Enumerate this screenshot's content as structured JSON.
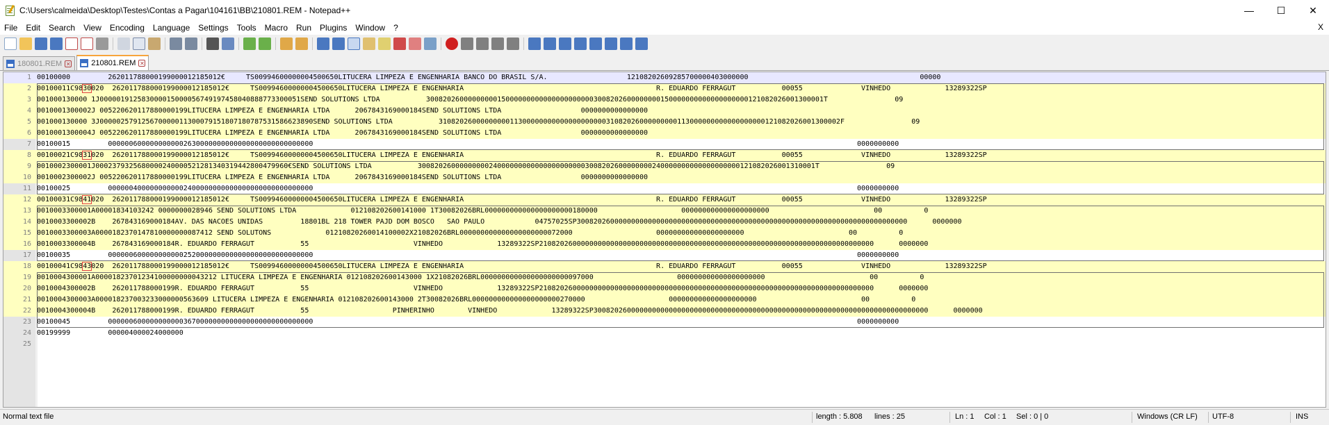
{
  "window": {
    "title": "C:\\Users\\calmeida\\Desktop\\Testes\\Contas a Pagar\\104161\\BB\\210801.REM - Notepad++",
    "minimize": "—",
    "maximize": "☐",
    "close": "✕"
  },
  "menu": {
    "items": [
      "File",
      "Edit",
      "Search",
      "View",
      "Encoding",
      "Language",
      "Settings",
      "Tools",
      "Macro",
      "Run",
      "Plugins",
      "Window",
      "?"
    ],
    "close_doc": "X"
  },
  "tabs": [
    {
      "label": "180801.REM",
      "active": false
    },
    {
      "label": "210801.REM",
      "active": true
    }
  ],
  "editor": {
    "lines": [
      {
        "n": "1",
        "text": "00100000         262011788000199000012185012€     TS00994600000004500650LITUCERA LIMPEZA E ENGENHARIA BANCO DO BRASIL S/A.                   12108202609285700000403000000                                         00000",
        "pre": "",
        "mark": "",
        "post": ""
      },
      {
        "n": "2",
        "pre": "00100011C98",
        "mark": "30",
        "post": "020  262011788000199000012185012€     TS00994600000004500650LITUCERA LIMPEZA E ENGENHARIA                                              R. EDUARDO FERRAGUT           00055              VINHEDO             13289322SP"
      },
      {
        "n": "3",
        "pre": "",
        "mark": "",
        "post": "001000130000 1J000001912583000015000056749197458040888773300051SEND SOLUTIONS LTDA           30082026000000000150000000000000000000003008202600000000150000000000000000000121082026001300001T                09"
      },
      {
        "n": "4",
        "pre": "",
        "mark": "",
        "post": "0010001300002J 005220620117880000199LITUCERA LIMPEZA E ENGENHARIA LTDA      2067843169000184SEND SOLUTIONS LTDA                   0000000000000000"
      },
      {
        "n": "5",
        "pre": "",
        "mark": "",
        "post": "001000130000 3J000002579125670000011300079151807180787531586623890SEND SOLUTIONS LTDA           310820260000000001130000000000000000000031082026000000000113000000000000000000121082026001300002F                09"
      },
      {
        "n": "6",
        "pre": "",
        "mark": "",
        "post": "0010001300004J 005220620117880000199LITUCERA LIMPEZA E ENGENHARIA LTDA      2067843169000184SEND SOLUTIONS LTDA                   0000000000000000"
      },
      {
        "n": "7",
        "pre": "",
        "mark": "",
        "post": "00100015         0000006000000000002630000000000000000000000000000                                                                                                                                  0000000000"
      },
      {
        "n": "8",
        "pre": "00100021C98",
        "mark": "31",
        "post": "020  262011788000199000012185012€     TS00994600000004500650LITUCERA LIMPEZA E ENGENHARIA                                              R. EDUARDO FERRAGUT           00055              VINHEDO             13289322SP"
      },
      {
        "n": "9",
        "pre": "",
        "mark": "",
        "post": "0010002300001J0002379325680000240000521281340319442800479960€SEND SOLUTIONS LTDA           30082026000000000240000000000000000000003008202600000000240000000000000000000121082026001310001T                09"
      },
      {
        "n": "10",
        "pre": "",
        "mark": "",
        "post": "0010002300002J 005220620117880000199LITUCERA LIMPEZA E ENGENHARIA LTDA      2067843169000184SEND SOLUTIONS LTDA                   0000000000000000"
      },
      {
        "n": "11",
        "pre": "",
        "mark": "",
        "post": "00100025         0000004000000000002400000000000000000000000000000                                                                                                                                  0000000000"
      },
      {
        "n": "12",
        "pre": "00100031C98",
        "mark": "41",
        "post": "020  262011788000199000012185012€     TS00994600000004500650LITUCERA LIMPEZA E ENGENHARIA                                              R. EDUARDO FERRAGUT           00055              VINHEDO             13289322SP"
      },
      {
        "n": "13",
        "pre": "",
        "mark": "",
        "post": "0010003300001A00001834103242 0000000028946 SEND SOLUTIONS LTDA             012108202600141000 1T30082026BRL000000000000000000000180000                    000000000000000000000                         00          0"
      },
      {
        "n": "14",
        "pre": "",
        "mark": "",
        "post": "0010003300002B    267843169000184AV. DAS NACOES UNIDAS         18801BL 218 TOWER PAJD DOM BOSCO   SAO PAULO            04757025SP3008202600000000000000000000000000000000000000000000000000000000000000000000000      0000000"
      },
      {
        "n": "15",
        "pre": "",
        "mark": "",
        "post": "0010003300003A0000182370147810000000087412 SEND SOLUTONS             01210820260014100002X21082026BRL000000000000000000000072000                    000000000000000000000                         00          0"
      },
      {
        "n": "16",
        "pre": "",
        "mark": "",
        "post": "0010003300004B    267843169000184R. EDUARDO FERRAGUT           55                         VINHEDO             13289322SP21082026000000000000000000000000000000000000000000000000000000000000000000000000      0000000"
      },
      {
        "n": "17",
        "pre": "",
        "mark": "",
        "post": "00100035         0000006000000000002520000000000000000000000000000                                                                                                                                  0000000000"
      },
      {
        "n": "18",
        "pre": "00100041C98",
        "mark": "43",
        "post": "020  262011788000199000012185012€     TS00994600000004500650LITUCERA LIMPEZA E ENGENHARIA                                              R. EDUARDO FERRAGUT           00055              VINHEDO             13289322SP"
      },
      {
        "n": "19",
        "pre": "",
        "mark": "",
        "post": "0010004300001A00001823701234100000000043212 LITUCERA LIMPEZA E ENGENHARIA 012108202600143000 1X21082026BRL000000000000000000000097000                    000000000000000000000                         00          0"
      },
      {
        "n": "20",
        "pre": "",
        "mark": "",
        "post": "0010004300002B    262011788000199R. EDUARDO FERRAGUT           55                         VINHEDO             13289322SP21082026000000000000000000000000000000000000000000000000000000000000000000000000      0000000"
      },
      {
        "n": "21",
        "pre": "",
        "mark": "",
        "post": "0010004300003A000018237003233000000563609 LITUCERA LIMPEZA E ENGENHARIA 012108202600143000 2T30082026BRL000000000000000000000270000                    000000000000000000000                         00          0"
      },
      {
        "n": "22",
        "pre": "",
        "mark": "",
        "post": "0010004300004B    262011788000199R. EDUARDO FERRAGUT           55                    PINHERINHO        VINHEDO             13289322SP30082026000000000000000000000000000000000000000000000000000000000000000000000000      0000000"
      },
      {
        "n": "23",
        "pre": "",
        "mark": "",
        "post": "00100045         0000006000000000003670000000000000000000000000000                                                                                                                                  0000000000"
      },
      {
        "n": "24",
        "pre": "",
        "mark": "",
        "post": "00199999         000004000024000000"
      },
      {
        "n": "25",
        "pre": "",
        "mark": "",
        "post": ""
      }
    ]
  },
  "status": {
    "type": "Normal text file",
    "length": "length : 5.808",
    "lines": "lines : 25",
    "ln": "Ln : 1",
    "col": "Col : 1",
    "sel": "Sel : 0 | 0",
    "eol": "Windows (CR LF)",
    "encoding": "UTF-8",
    "ins": "INS"
  }
}
